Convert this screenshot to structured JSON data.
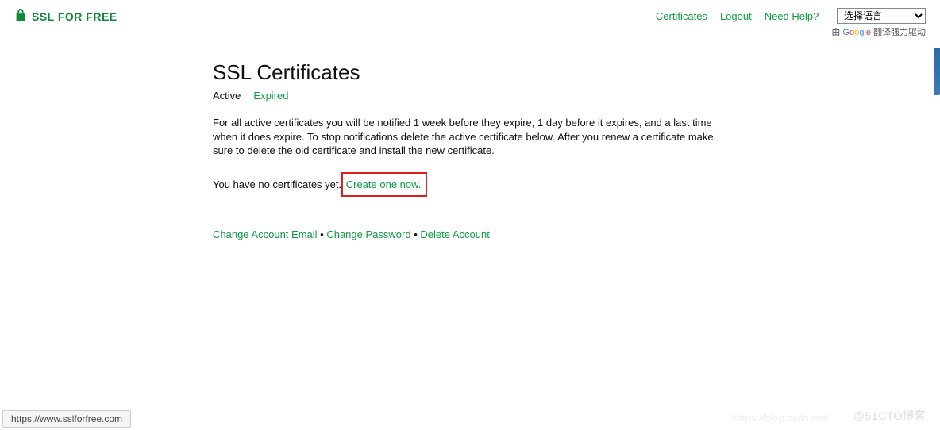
{
  "header": {
    "brand": "SSL FOR FREE",
    "nav": {
      "certificates": "Certificates",
      "logout": "Logout",
      "help": "Need Help?"
    },
    "lang": {
      "selected": "选择语言",
      "caption_prefix": "由 ",
      "caption_suffix": " 翻译强力驱动"
    }
  },
  "main": {
    "title": "SSL Certificates",
    "tabs": {
      "active": "Active",
      "expired": "Expired"
    },
    "info": "For all active certificates you will be notified 1 week before they expire, 1 day before it expires, and a last time when it does expire. To stop notifications delete the active certificate below. After you renew a certificate make sure to delete the old certificate and install the new certificate.",
    "nocerts_prefix": "You have no certificates yet. ",
    "create_link": "Create one now.",
    "account": {
      "change_email": "Change Account Email",
      "change_password": "Change Password",
      "delete_account": "Delete Account"
    }
  },
  "statusbar": {
    "url": "https://www.sslforfree.com"
  },
  "watermark": {
    "right": "@51CTO博客",
    "left": "https://blog.csdn.net/"
  }
}
